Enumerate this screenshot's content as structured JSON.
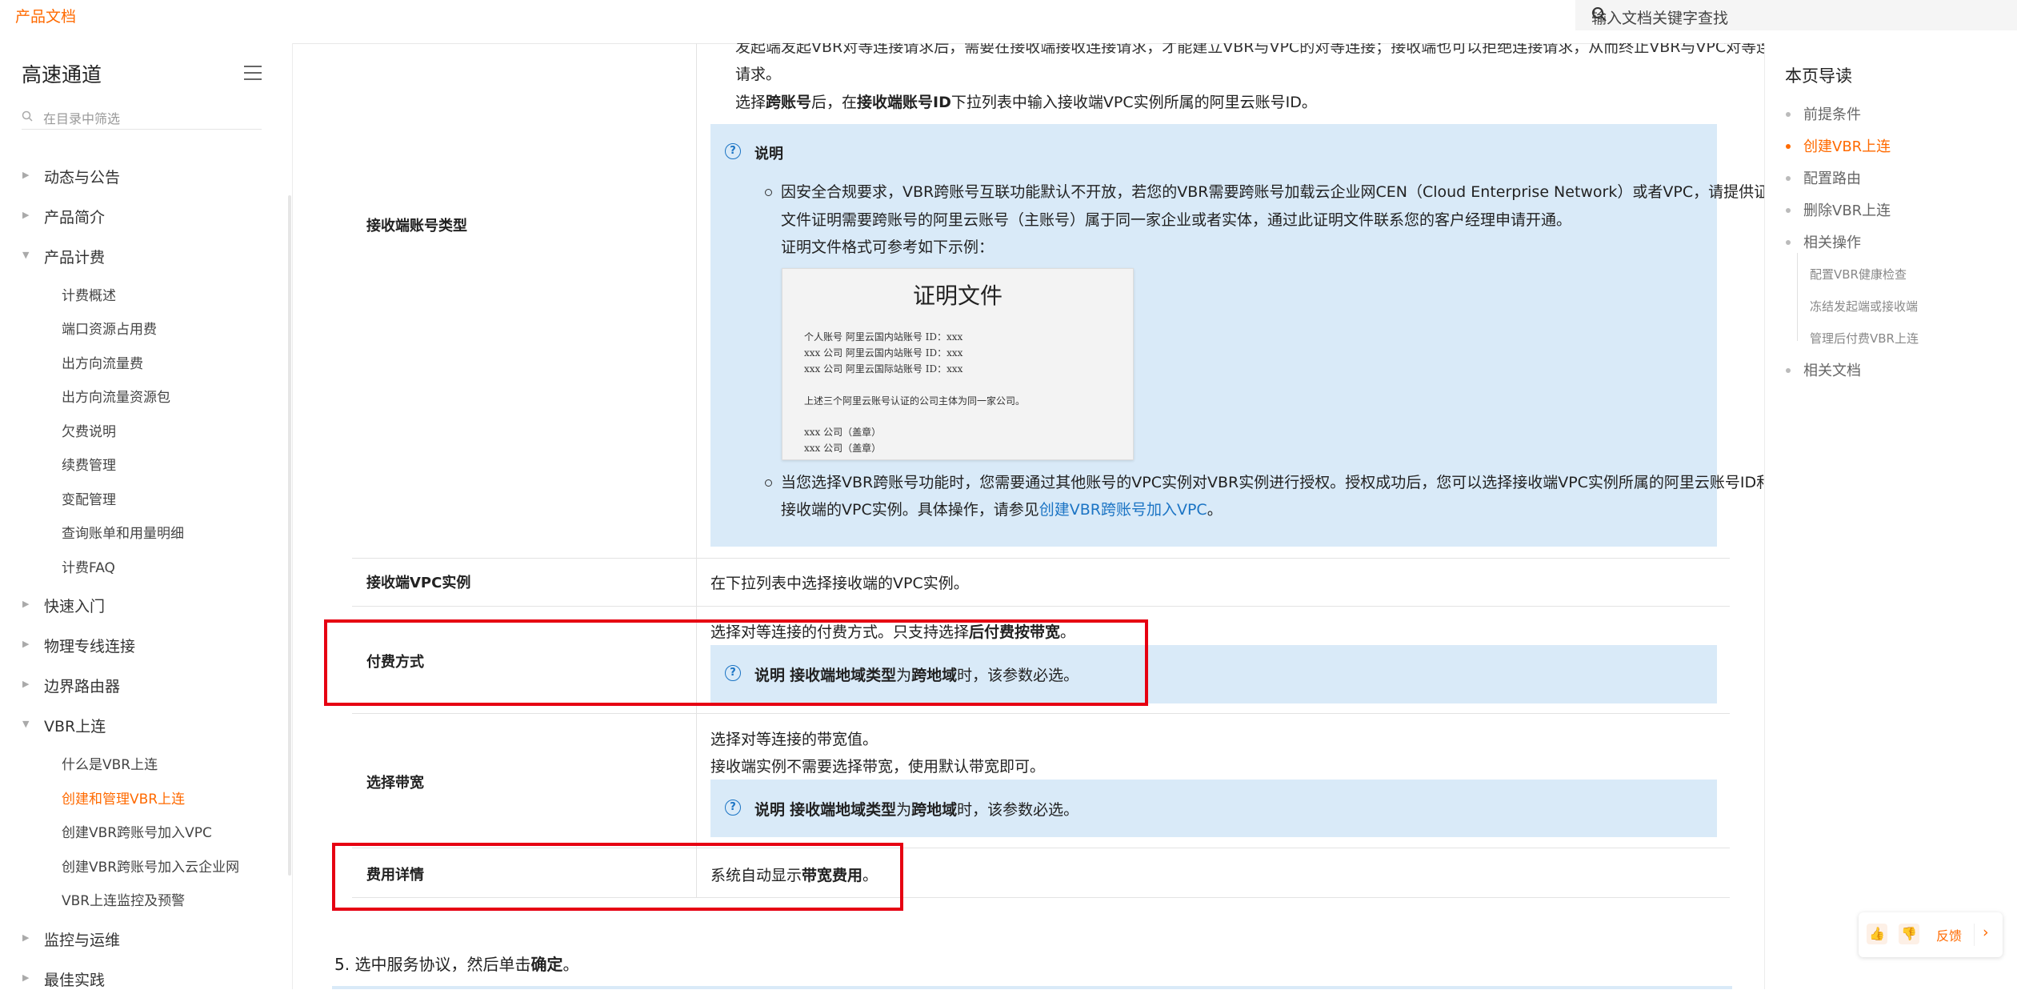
{
  "header": {
    "brand": "产品文档",
    "search_placeholder": "输入文档关键字查找"
  },
  "sidebar": {
    "title": "高速通道",
    "filter_placeholder": "在目录中筛选",
    "l1": [
      "动态与公告",
      "产品简介",
      "产品计费",
      "快速入门",
      "物理专线连接",
      "边界路由器",
      "VBR上连",
      "监控与运维",
      "最佳实践"
    ],
    "billing_sub": [
      "计费概述",
      "端口资源占用费",
      "出方向流量费",
      "出方向流量资源包",
      "欠费说明",
      "续费管理",
      "变配管理",
      "查询账单和用量明细",
      "计费FAQ"
    ],
    "vbr_sub": [
      "什么是VBR上连",
      "创建和管理VBR上连",
      "创建VBR跨账号加入VPC",
      "创建VBR跨账号加入云企业网",
      "VBR上连监控及预警"
    ]
  },
  "content": {
    "top_line1": "发起端发起VBR对等连接请求后，需要在接收端接收连接请求，才能建立VBR与VPC的对等连接；接收端也可以拒绝连接请求，从而终止VBR与VPC对等连接的",
    "top_line2": "请求。",
    "top_line3_a": "选择",
    "top_line3_b": "跨账号",
    "top_line3_c": "后，在",
    "top_line3_d": "接收端账号ID",
    "top_line3_e": "下拉列表中输入接收端VPC实例所属的阿里云账号ID。",
    "row1_label": "接收端账号类型",
    "note_title": "说明",
    "bullet1_line1": "因安全合规要求，VBR跨账号互联功能默认不开放，若您的VBR需要跨账号加载云企业网CEN（Cloud Enterprise Network）或者VPC，请提供证明",
    "bullet1_line2": "文件证明需要跨账号的阿里云账号（主账号）属于同一家企业或者实体，通过此证明文件联系您的客户经理申请开通。",
    "bullet1_line3": "证明文件格式可参考如下示例：",
    "cert": {
      "title": "证明文件",
      "l1": "个人账号        阿里云国内站账号 ID：xxx",
      "l2": "xxx 公司        阿里云国内站账号 ID：xxx",
      "l3": "xxx 公司        阿里云国际站账号 ID：xxx",
      "l4": "上述三个阿里云账号认证的公司主体为同一家公司。",
      "l5": "xxx 公司（盖章）",
      "l6": "xxx 公司（盖章）"
    },
    "bullet2_line1": "当您选择VBR跨账号功能时，您需要通过其他账号的VPC实例对VBR实例进行授权。授权成功后，您可以选择接收端VPC实例所属的阿里云账号ID和",
    "bullet2_line2_a": "接收端的VPC实例。具体操作，请参见",
    "bullet2_link": "创建VBR跨账号加入VPC",
    "bullet2_line2_b": "。",
    "row2_label": "接收端VPC实例",
    "row2_text": "在下拉列表中选择接收端的VPC实例。",
    "row3_label": "付费方式",
    "row3_text_a": "选择对等连接的付费方式。只支持选择",
    "row3_text_b": "后付费按带宽",
    "row3_text_c": "。",
    "row3_note_a": "说明",
    "row3_note_b": "接收端地域类型",
    "row3_note_c": "为",
    "row3_note_d": "跨地域",
    "row3_note_e": "时，该参数必选。",
    "row4_label": "选择带宽",
    "row4_text1": "选择对等连接的带宽值。",
    "row4_text2": "接收端实例不需要选择带宽，使用默认带宽即可。",
    "row4_note_a": "说明",
    "row4_note_b": "接收端地域类型",
    "row4_note_c": "为",
    "row4_note_d": "跨地域",
    "row4_note_e": "时，该参数必选。",
    "row5_label": "费用详情",
    "row5_text_a": "系统自动显示",
    "row5_text_b": "带宽费用",
    "row5_text_c": "。",
    "step5_a": "5. 选中服务协议，然后单击",
    "step5_b": "确定",
    "step5_c": "。"
  },
  "toc": {
    "title": "本页导读",
    "items": [
      "前提条件",
      "创建VBR上连",
      "配置路由",
      "删除VBR上连",
      "相关操作"
    ],
    "sub": [
      "配置VBR健康检查",
      "冻结发起端或接收端",
      "管理后付费VBR上连"
    ],
    "last": "相关文档"
  },
  "feedback": {
    "label": "反馈"
  },
  "colors": {
    "accent": "#ff6a00",
    "link": "#1b74c4",
    "note_bg": "#d9eaf8",
    "highlight": "#e60012"
  }
}
